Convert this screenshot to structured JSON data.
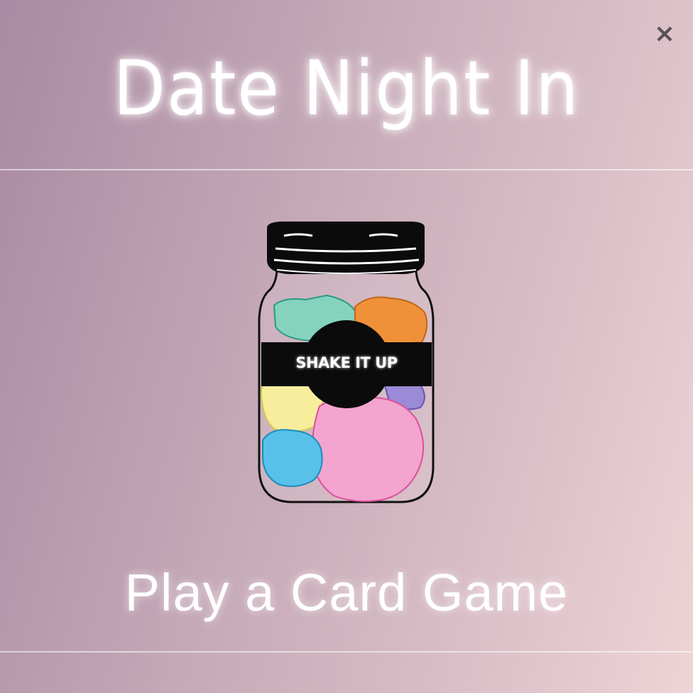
{
  "header": {
    "title": "Date Night In",
    "close_label": "×"
  },
  "jar": {
    "button_label": "SHAKE IT UP",
    "paper_colors": [
      "#85d3bd",
      "#f0913a",
      "#f6ee9c",
      "#f3a5cf",
      "#57c1ea",
      "#9b8ad6"
    ],
    "lid_color": "#0b0b0b"
  },
  "footer": {
    "cta_label": "Play a Card Game"
  },
  "colors": {
    "background_start": "#a98aa2",
    "background_end": "#eed4d6",
    "text": "#ffffff",
    "close_icon": "#5a5058"
  }
}
